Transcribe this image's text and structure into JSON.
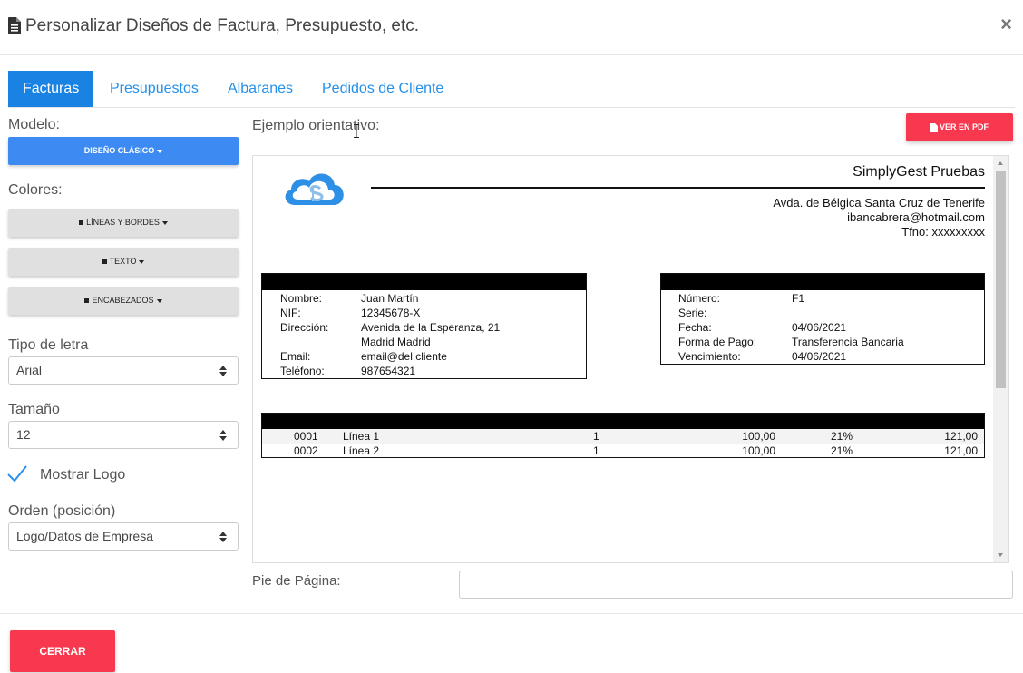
{
  "header": {
    "title": "Personalizar Diseños de Factura, Presupuesto, etc.",
    "close_label": "×"
  },
  "tabs": [
    {
      "label": "Facturas",
      "active": true
    },
    {
      "label": "Presupuestos",
      "active": false
    },
    {
      "label": "Albaranes",
      "active": false
    },
    {
      "label": "Pedidos de Cliente",
      "active": false
    }
  ],
  "sidebar": {
    "modelo_label": "Modelo:",
    "modelo_button": "DISEÑO CLÁSICO",
    "colores_label": "Colores:",
    "color_buttons": [
      "LÍNEAS Y BORDES",
      "TEXTO",
      "ENCABEZADOS"
    ],
    "tipo_letra_label": "Tipo de letra",
    "tipo_letra_value": "Arial",
    "tamano_label": "Tamaño",
    "tamano_value": "12",
    "mostrar_logo_label": "Mostrar Logo",
    "mostrar_logo_checked": true,
    "orden_label": "Orden (posición)",
    "orden_value": "Logo/Datos de Empresa"
  },
  "preview": {
    "label": "Ejemplo orientativo:",
    "pdf_button": "VER EN PDF",
    "company": {
      "name": "SimplyGest Pruebas",
      "address": "Avda. de Bélgica Santa Cruz de Tenerife",
      "email": "ibancabrera@hotmail.com",
      "phone": "Tfno: xxxxxxxxx"
    },
    "client": [
      {
        "key": "Nombre:",
        "value": "Juan Martín"
      },
      {
        "key": "NIF:",
        "value": "12345678-X"
      },
      {
        "key": "Dirección:",
        "value": "Avenida de la Esperanza, 21"
      },
      {
        "key": "",
        "value": "Madrid Madrid"
      },
      {
        "key": "Email:",
        "value": "email@del.cliente"
      },
      {
        "key": "Teléfono:",
        "value": "987654321"
      }
    ],
    "invoice": [
      {
        "key": "Número:",
        "value": "F1"
      },
      {
        "key": "Serie:",
        "value": ""
      },
      {
        "key": "Fecha:",
        "value": "04/06/2021"
      },
      {
        "key": "Forma de Pago:",
        "value": "Transferencia Bancaria"
      },
      {
        "key": "Vencimiento:",
        "value": "04/06/2021"
      }
    ],
    "lines": [
      {
        "code": "0001",
        "desc": "Línea 1",
        "qty": "1",
        "price": "100,00",
        "tax": "21%",
        "total": "121,00"
      },
      {
        "code": "0002",
        "desc": "Línea 2",
        "qty": "1",
        "price": "100,00",
        "tax": "21%",
        "total": "121,00"
      }
    ]
  },
  "footer": {
    "pie_label": "Pie de Página:",
    "pie_value": "",
    "close_button": "CERRAR"
  },
  "colors": {
    "accent_blue": "#1a82e2",
    "button_blue": "#3d8bf2",
    "danger_red": "#f8384e",
    "logo_blue": "#2d8fe6"
  }
}
